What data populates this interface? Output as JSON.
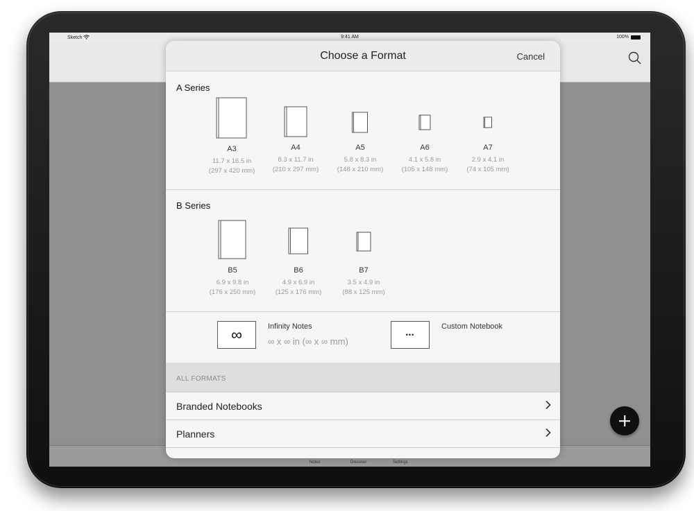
{
  "status_bar": {
    "carrier": "Sketch",
    "time": "9:41 AM",
    "battery": "100%"
  },
  "modal": {
    "title": "Choose a Format",
    "cancel_label": "Cancel"
  },
  "a_series": {
    "title": "A Series",
    "items": [
      {
        "name": "A3",
        "size_in": "11.7 x 16.5 in",
        "size_mm": "(297 x 420 mm)"
      },
      {
        "name": "A4",
        "size_in": "8.3 x 11.7 in",
        "size_mm": "(210 x 297 mm)"
      },
      {
        "name": "A5",
        "size_in": "5.8 x 8.3 in",
        "size_mm": "(148 x 210 mm)"
      },
      {
        "name": "A6",
        "size_in": "4.1 x 5.8 in",
        "size_mm": "(105 x 148 mm)"
      },
      {
        "name": "A7",
        "size_in": "2.9 x 4.1 in",
        "size_mm": "(74 x 105 mm)"
      }
    ]
  },
  "b_series": {
    "title": "B Series",
    "items": [
      {
        "name": "B5",
        "size_in": "6.9 x 9.8 in",
        "size_mm": "(176 x 250 mm)"
      },
      {
        "name": "B6",
        "size_in": "4.9 x 6.9 in",
        "size_mm": "(125 x 176 mm)"
      },
      {
        "name": "B7",
        "size_in": "3.5 x 4.9 in",
        "size_mm": "(88 x 125 mm)"
      }
    ]
  },
  "special": {
    "infinity": {
      "label": "Infinity Notes",
      "size": "∞ x ∞ in (∞ x ∞ mm)",
      "symbol": "∞"
    },
    "custom": {
      "label": "Custom Notebook",
      "symbol": "•••"
    }
  },
  "all_formats": {
    "header": "ALL FORMATS",
    "rows": [
      {
        "label": "Branded Notebooks"
      },
      {
        "label": "Planners"
      }
    ]
  },
  "tab_bar": {
    "tabs": [
      "Notes",
      "Discover",
      "Settings"
    ]
  },
  "colors": {
    "modal_bg": "#f6f6f6",
    "header_bg": "#ececec",
    "muted_text": "#9a9a9a",
    "fab_bg": "#101010"
  }
}
